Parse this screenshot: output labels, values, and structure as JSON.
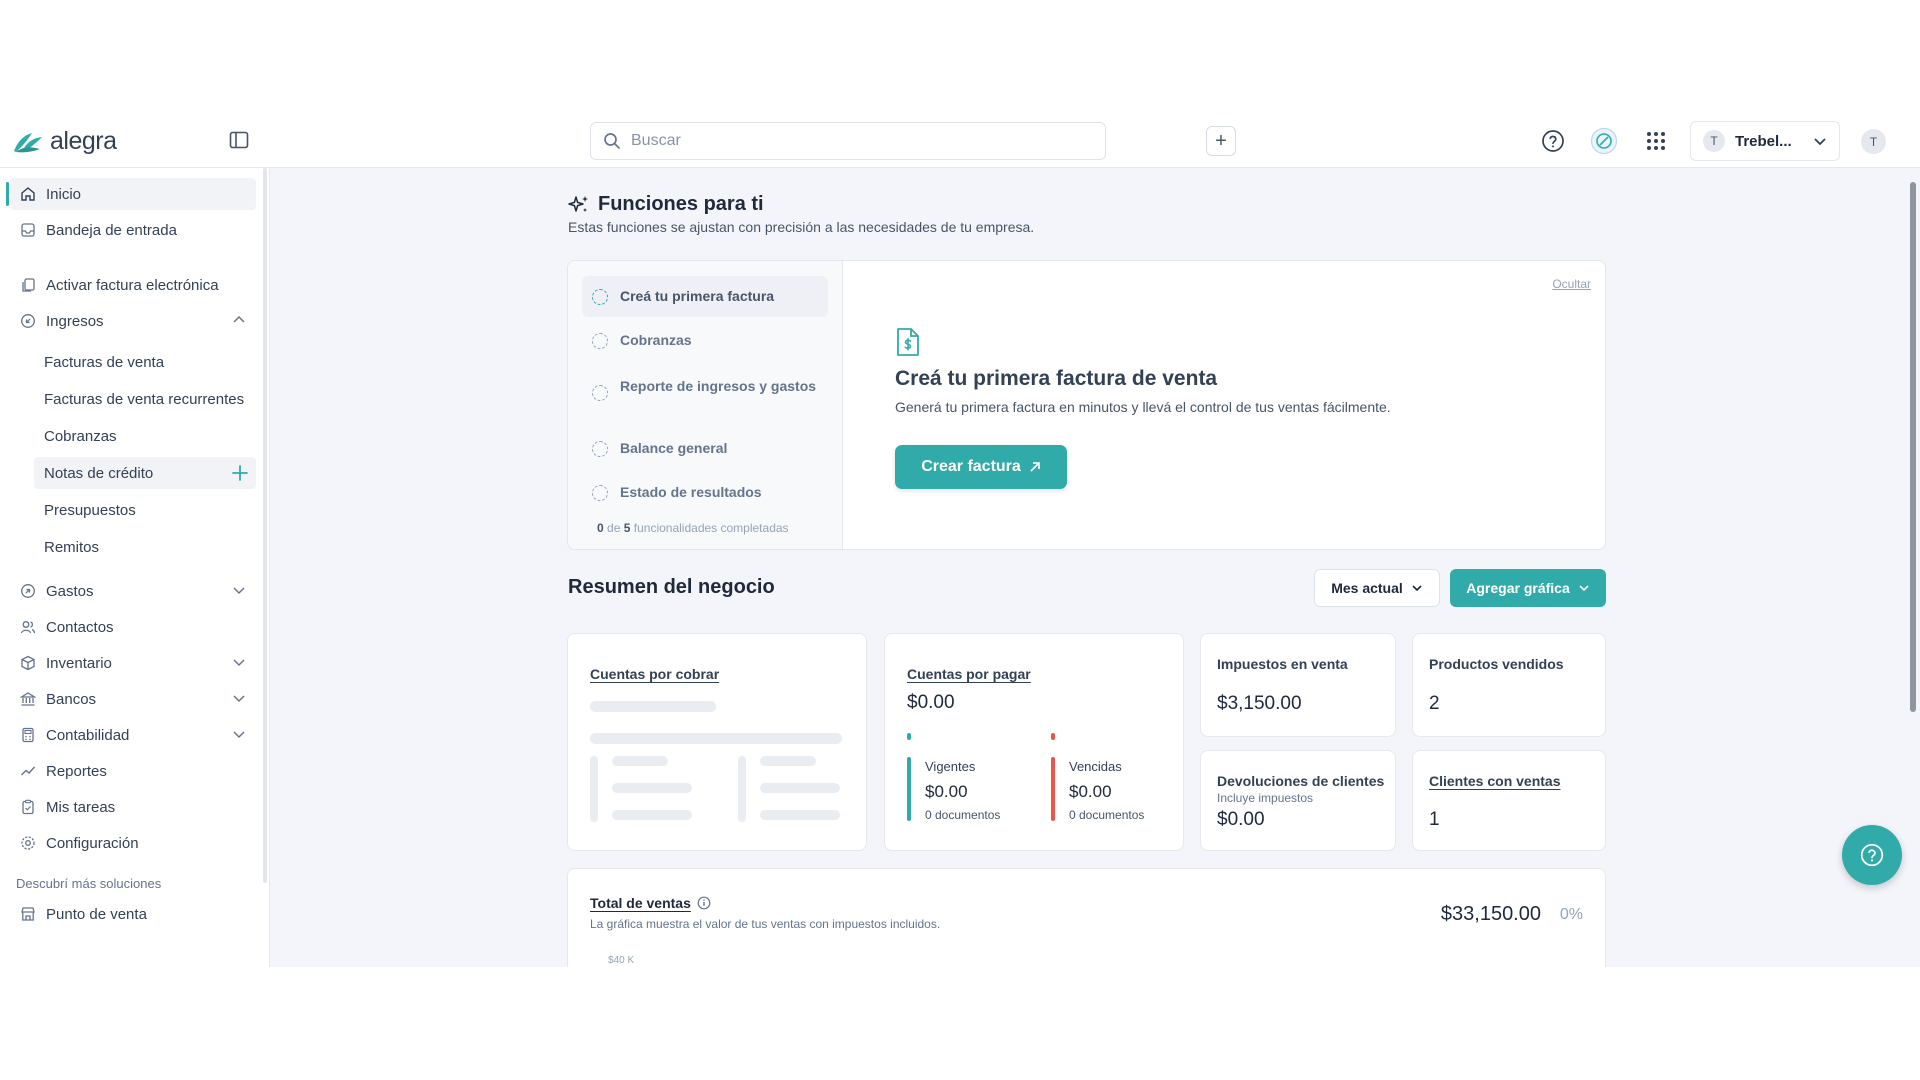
{
  "header": {
    "brand": "alegra",
    "search_placeholder": "Buscar",
    "new_button": "+",
    "company_initial": "T",
    "company_name": "Trebel...",
    "user_initial": "T"
  },
  "sidebar": {
    "items": [
      {
        "label": "Inicio"
      },
      {
        "label": "Bandeja de entrada"
      },
      {
        "label": "Activar factura electrónica"
      },
      {
        "label": "Ingresos"
      },
      {
        "label": "Gastos"
      },
      {
        "label": "Contactos"
      },
      {
        "label": "Inventario"
      },
      {
        "label": "Bancos"
      },
      {
        "label": "Contabilidad"
      },
      {
        "label": "Reportes"
      },
      {
        "label": "Mis tareas"
      },
      {
        "label": "Configuración"
      }
    ],
    "ingresos_sub": [
      {
        "label": "Facturas de venta"
      },
      {
        "label": "Facturas de venta recurrentes"
      },
      {
        "label": "Cobranzas"
      },
      {
        "label": "Notas de crédito"
      },
      {
        "label": "Presupuestos"
      },
      {
        "label": "Remitos"
      }
    ],
    "section_more": "Descubrí más soluciones",
    "extra_items": [
      {
        "label": "Punto de venta"
      }
    ]
  },
  "features": {
    "title": "Funciones para ti",
    "description": "Estas funciones se ajustan con precisión a las necesidades de tu empresa.",
    "steps": [
      {
        "label": "Creá tu primera factura"
      },
      {
        "label": "Cobranzas"
      },
      {
        "label": "Reporte de ingresos y gastos"
      },
      {
        "label": "Balance general"
      },
      {
        "label": "Estado de resultados"
      }
    ],
    "progress_done": "0",
    "progress_de": "de",
    "progress_total": "5",
    "progress_text": "funcionalidades completadas",
    "hide_label": "Ocultar",
    "detail_title": "Creá tu primera factura de venta",
    "detail_text": "Generá tu primera factura en minutos y llevá el control de tus ventas fácilmente.",
    "cta": "Crear factura"
  },
  "summary": {
    "title": "Resumen del negocio",
    "period_button": "Mes actual",
    "add_chart_button": "Agregar gráfica",
    "receivables_title": "Cuentas por cobrar",
    "payables": {
      "title": "Cuentas por pagar",
      "value": "$0.00",
      "current_label": "Vigentes",
      "current_value": "$0.00",
      "current_docs": "0 documentos",
      "overdue_label": "Vencidas",
      "overdue_value": "$0.00",
      "overdue_docs": "0 documentos"
    },
    "taxes": {
      "title": "Impuestos en venta",
      "value": "$3,150.00"
    },
    "products_sold": {
      "title": "Productos vendidos",
      "value": "2"
    },
    "returns": {
      "title": "Devoluciones de clientes",
      "subtitle": "Incluye impuestos",
      "value": "$0.00"
    },
    "clients": {
      "title": "Clientes con ventas",
      "value": "1"
    }
  },
  "sales": {
    "title": "Total de ventas",
    "subtitle": "La gráfica muestra el valor de tus ventas con impuestos incluidos.",
    "total": "$33,150.00",
    "change": "0%",
    "axis_top": "$40 K"
  },
  "colors": {
    "accent": "#30aba9",
    "overdue": "#e8564a"
  }
}
